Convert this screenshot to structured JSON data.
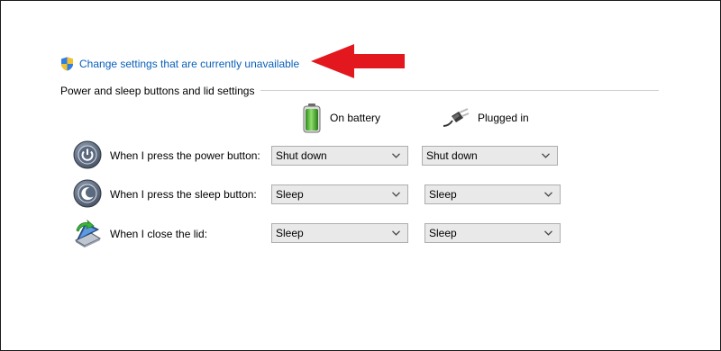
{
  "colors": {
    "link": "#0a60b8",
    "arrow": "#e3171e",
    "dropdown_bg": "#e9e9e9",
    "dropdown_border": "#adadad",
    "section_rule": "#cfcfcf"
  },
  "header_link": {
    "icon": "uac-shield-icon",
    "text": "Change settings that are currently unavailable"
  },
  "annotation": {
    "icon": "red-arrow-icon",
    "points_to": "header_link"
  },
  "section": {
    "title": "Power and sleep buttons and lid settings"
  },
  "columns": [
    {
      "icon": "battery-icon",
      "label": "On battery"
    },
    {
      "icon": "power-plug-icon",
      "label": "Plugged in"
    }
  ],
  "rows": [
    {
      "icon": "power-button-icon",
      "label": "When I press the power button:",
      "on_battery": "Shut down",
      "plugged_in": "Shut down"
    },
    {
      "icon": "sleep-button-icon",
      "label": "When I press the sleep button:",
      "on_battery": "Sleep",
      "plugged_in": "Sleep"
    },
    {
      "icon": "laptop-lid-icon",
      "label": "When I close the lid:",
      "on_battery": "Sleep",
      "plugged_in": "Sleep"
    }
  ]
}
